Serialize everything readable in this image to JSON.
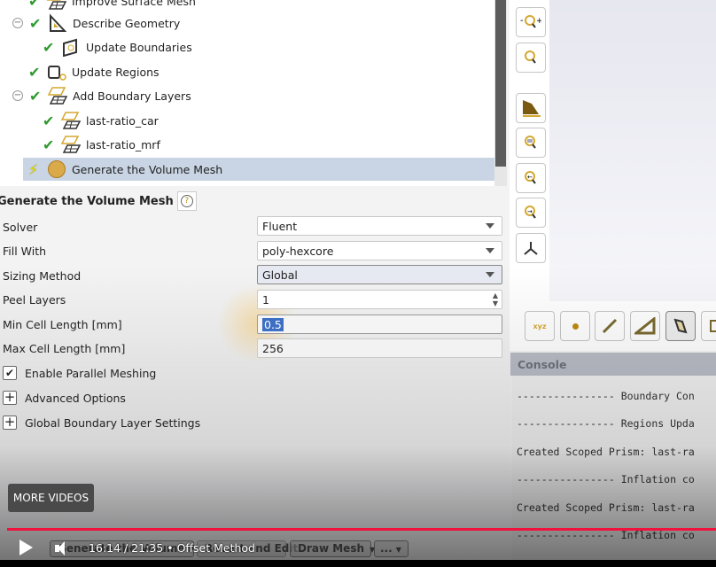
{
  "tree": {
    "items": [
      {
        "label": "Improve Surface Mesh",
        "icon": "mesh-icon"
      },
      {
        "label": "Describe Geometry",
        "icon": "geometry-icon",
        "collapsible": true
      },
      {
        "label": "Update Boundaries",
        "icon": "boundaries-icon"
      },
      {
        "label": "Update Regions",
        "icon": "regions-icon"
      },
      {
        "label": "Add Boundary Layers",
        "icon": "layers-icon",
        "collapsible": true
      },
      {
        "label": "last-ratio_car",
        "icon": "layers-icon"
      },
      {
        "label": "last-ratio_mrf",
        "icon": "layers-icon"
      },
      {
        "label": "Generate the Volume Mesh",
        "icon": "volume-mesh-icon",
        "selected": true
      }
    ]
  },
  "form": {
    "title": "Generate the Volume Mesh",
    "help": "?",
    "solver": {
      "label": "Solver",
      "value": "Fluent"
    },
    "fill_with": {
      "label": "Fill With",
      "value": "poly-hexcore"
    },
    "sizing_method": {
      "label": "Sizing Method",
      "value": "Global"
    },
    "peel_layers": {
      "label": "Peel Layers",
      "value": "1"
    },
    "min_cell": {
      "label": "Min Cell Length [mm]",
      "value": "0.5"
    },
    "max_cell": {
      "label": "Max Cell Length [mm]",
      "value": "256"
    },
    "parallel": {
      "label": "Enable Parallel Meshing",
      "checked": true
    },
    "advanced": {
      "label": "Advanced Options"
    },
    "global_bl": {
      "label": "Global Boundary Layer Settings"
    }
  },
  "console": {
    "title": "Console",
    "lines": [
      "---------------- Boundary Con",
      "---------------- Regions Upda",
      "Created Scoped Prism: last-ra",
      "---------------- Inflation co",
      "Created Scoped Prism: last-ra",
      "---------------- Inflation co"
    ]
  },
  "bottom_buttons": {
    "generate": "Generate the Volume Mesh",
    "revert": "Revert and Edit",
    "draw": "Draw Mesh",
    "more": "..."
  },
  "video": {
    "more_videos": "MORE VIDEOS",
    "time": "16:14 / 21:35",
    "chapter": "Offset Method",
    "separator": "•",
    "accent": "#f0123d"
  }
}
